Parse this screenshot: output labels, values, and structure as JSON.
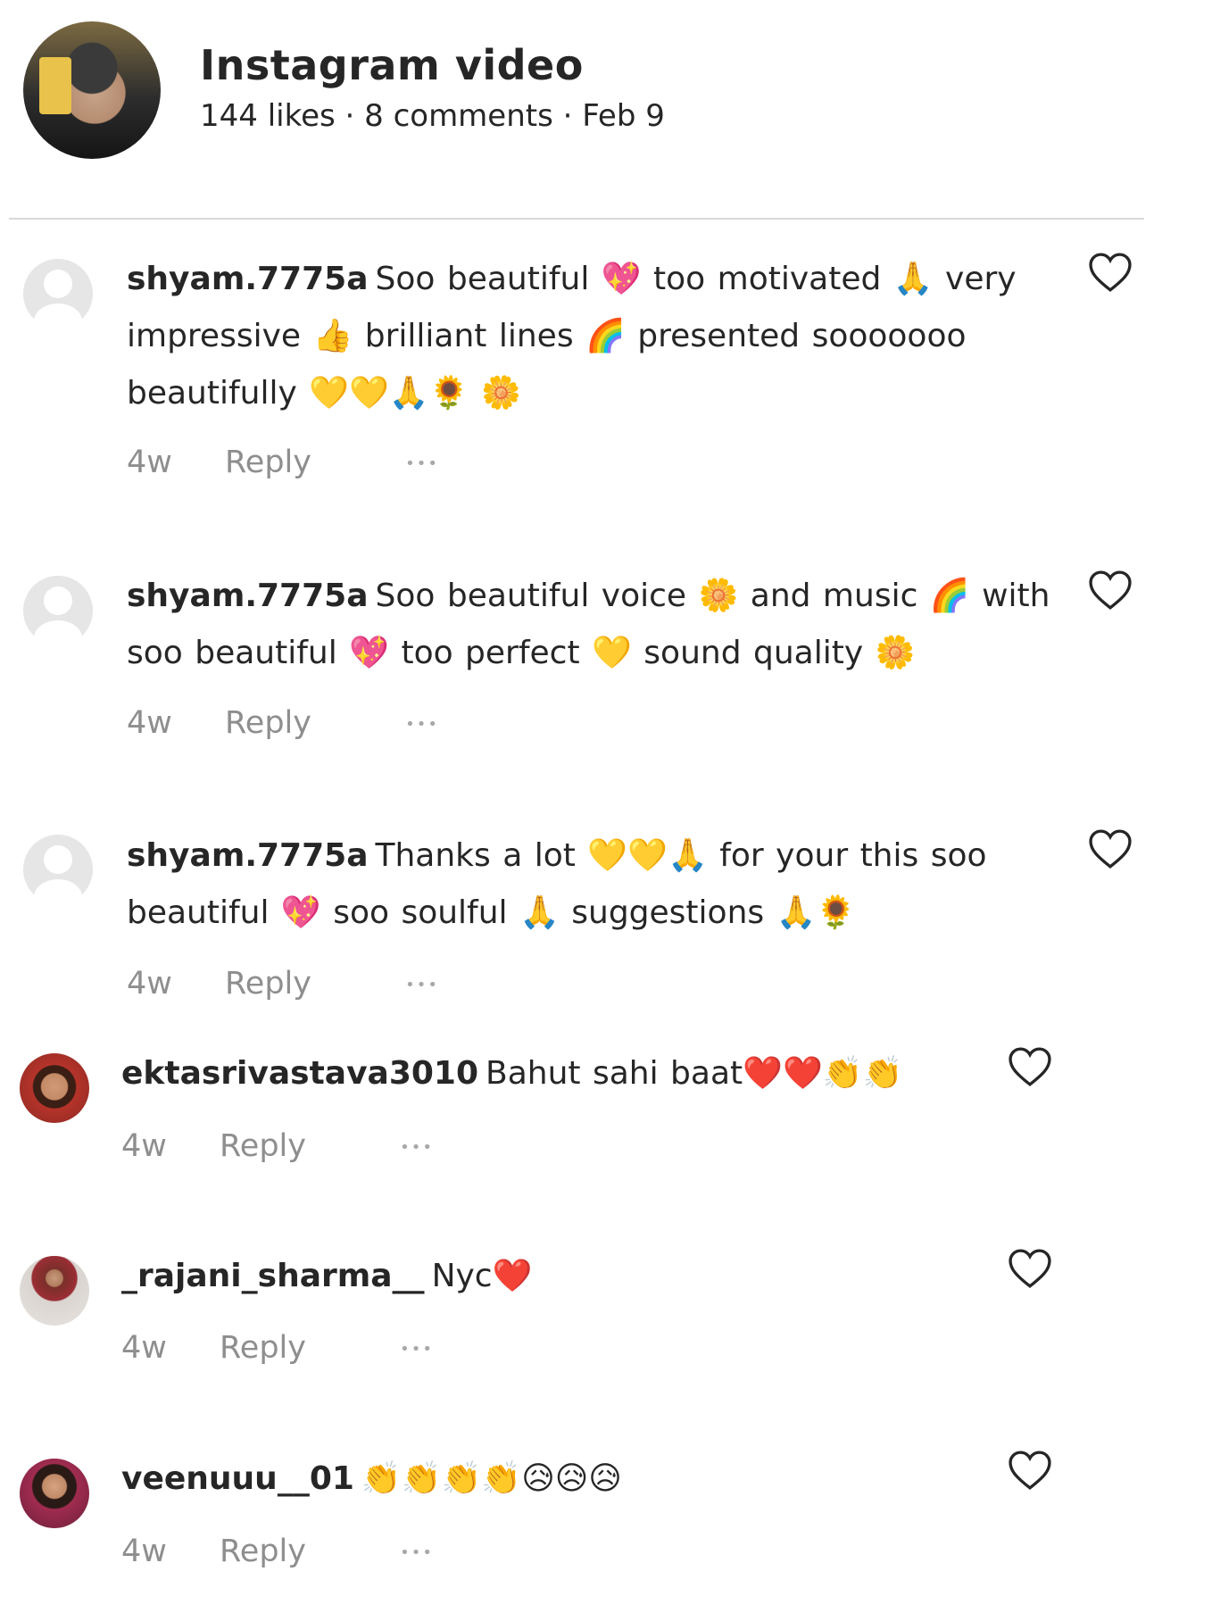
{
  "post": {
    "title": "Instagram video",
    "meta": "144 likes · 8 comments · Feb 9"
  },
  "comments": [
    {
      "username": "shyam.7775a",
      "text": "Soo beautiful 💖 too motivated 🙏 very impressive 👍 brilliant lines 🌈 presented sooooooo beautifully 💛💛🙏🌻 🌼",
      "age": "4w",
      "reply": "Reply",
      "more": "•••"
    },
    {
      "username": "shyam.7775a",
      "text": "Soo beautiful voice 🌼 and music 🌈 with soo beautiful 💖 too perfect 💛 sound quality 🌼",
      "age": "4w",
      "reply": "Reply",
      "more": "•••"
    },
    {
      "username": "shyam.7775a",
      "text": "Thanks a lot 💛💛🙏 for your this soo beautiful 💖 soo soulful 🙏 suggestions 🙏🌻",
      "age": "4w",
      "reply": "Reply",
      "more": "•••"
    },
    {
      "username": "ektasrivastava3010",
      "text": "Bahut sahi baat❤️❤️👏👏",
      "age": "4w",
      "reply": "Reply",
      "more": "•••"
    },
    {
      "username": "_rajani_sharma__",
      "text": "Nyc❤️",
      "age": "4w",
      "reply": "Reply",
      "more": "•••"
    },
    {
      "username": "veenuuu__01",
      "text": "👏👏👏👏😥😥😥",
      "age": "4w",
      "reply": "Reply",
      "more": "•••"
    }
  ],
  "icons": {
    "heart": "heart-outline-icon",
    "default_avatar": "default-avatar-icon"
  }
}
